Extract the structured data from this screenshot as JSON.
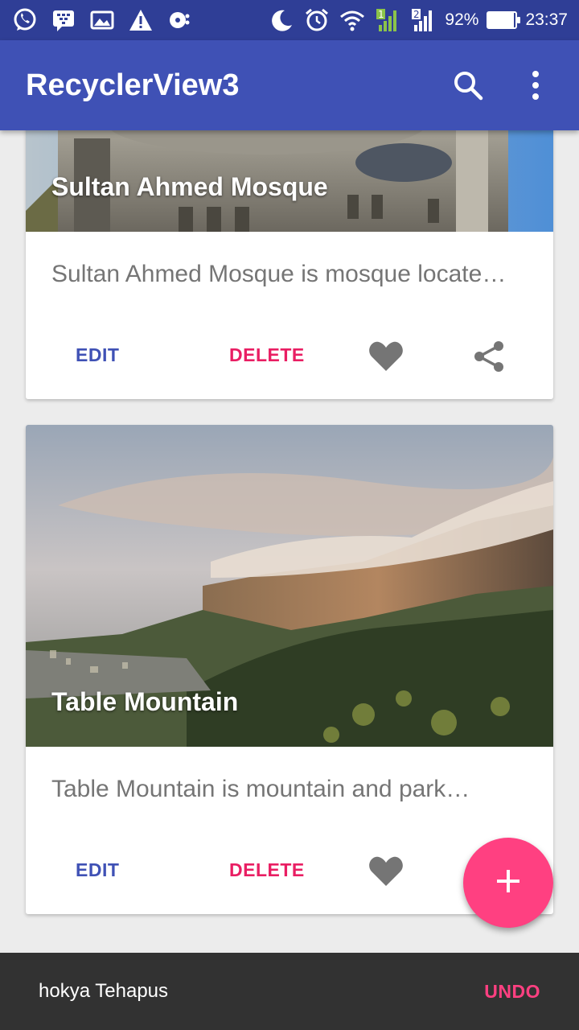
{
  "status_bar": {
    "battery_percent": "92%",
    "battery_level": 0.92,
    "time": "23:37",
    "sim1": "1",
    "sim2": "2",
    "left_icons": [
      "whatsapp-icon",
      "bbm-icon",
      "gallery-icon",
      "warning-icon",
      "sync-icon"
    ],
    "right_icons": [
      "moon-icon",
      "alarm-icon",
      "wifi-icon",
      "signal-icon",
      "signal-icon",
      "battery-icon"
    ]
  },
  "app_bar": {
    "title": "RecyclerView3",
    "color": "#3f51b5",
    "icons": [
      "search-icon",
      "more-vert-icon"
    ]
  },
  "cards": [
    {
      "title": "Sultan Ahmed Mosque",
      "description": "Sultan Ahmed Mosque is mosque locate…",
      "edit_label": "EDIT",
      "delete_label": "DELETE",
      "icons": [
        "heart-icon",
        "share-icon"
      ]
    },
    {
      "title": "Table Mountain",
      "description": "Table Mountain is mountain and park…",
      "edit_label": "EDIT",
      "delete_label": "DELETE",
      "icons": [
        "heart-icon"
      ]
    }
  ],
  "fab": {
    "icon": "add-icon",
    "color": "#ff4081"
  },
  "snackbar": {
    "message": "hokya Tehapus",
    "action_label": "UNDO",
    "action_color": "#ff4081"
  }
}
